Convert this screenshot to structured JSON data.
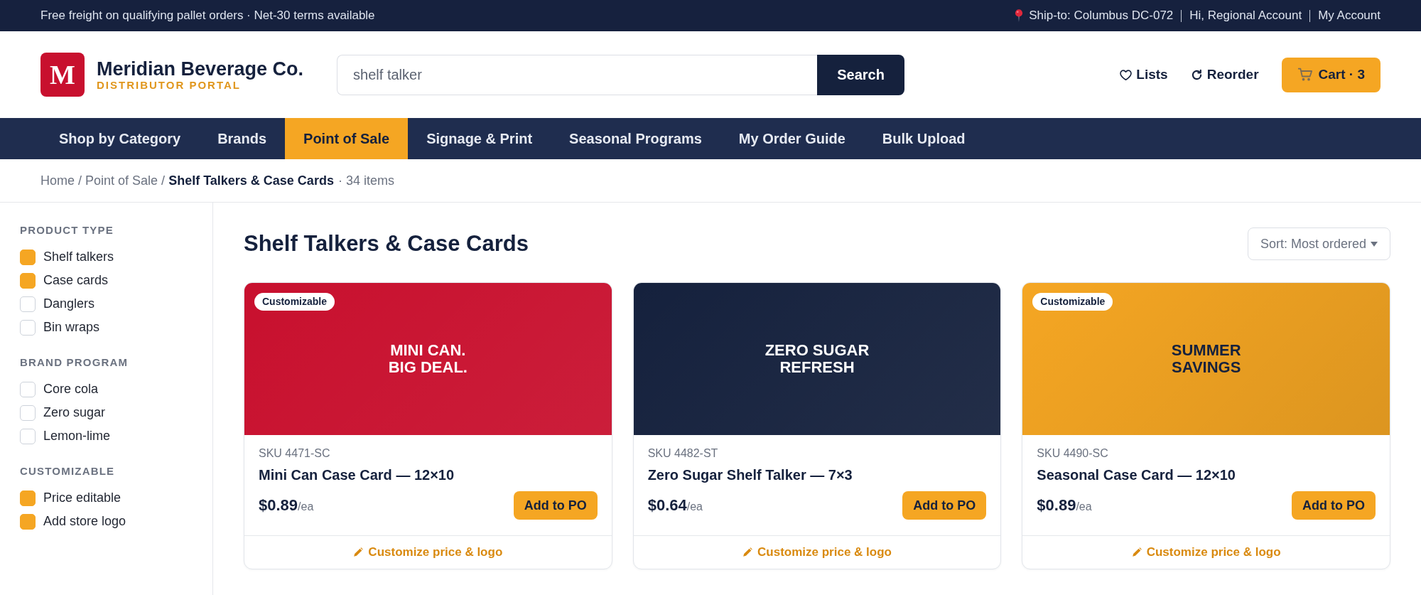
{
  "top_bar": {
    "promo": "Free freight on qualifying pallet orders · Net-30 terms available",
    "ship_to": "Ship-to: Columbus DC-072",
    "greeting": "Hi, Regional Account",
    "account_link": "My Account"
  },
  "header": {
    "logo": {
      "letter": "M",
      "name": "Meridian Beverage Co.",
      "tagline": "DISTRIBUTOR PORTAL"
    },
    "search": {
      "value": "shelf talker",
      "button": "Search"
    },
    "actions": [
      {
        "kind": "lists",
        "label": "Lists"
      },
      {
        "kind": "reorder",
        "label": "Reorder"
      },
      {
        "kind": "cart",
        "label": "Cart · 3"
      }
    ]
  },
  "nav": {
    "items": [
      {
        "label": "Shop by Category",
        "selected": false
      },
      {
        "label": "Brands",
        "selected": false
      },
      {
        "label": "Point of Sale",
        "selected": true
      },
      {
        "label": "Signage & Print",
        "selected": false
      },
      {
        "label": "Seasonal Programs",
        "selected": false
      },
      {
        "label": "My Order Guide",
        "selected": false
      },
      {
        "label": "Bulk Upload",
        "selected": false
      }
    ]
  },
  "breadcrumb": {
    "crumbs": [
      {
        "label": "Home",
        "current": false
      },
      {
        "separator": "/",
        "label": "Point of Sale",
        "current": false
      },
      {
        "separator": "/",
        "label": "Shelf Talkers & Case Cards",
        "current": true
      }
    ],
    "count": "· 34 items"
  },
  "filters": [
    {
      "title": "PRODUCT TYPE",
      "options": [
        {
          "label": "Shelf talkers",
          "checked": true
        },
        {
          "label": "Case cards",
          "checked": true
        },
        {
          "label": "Danglers",
          "checked": false
        },
        {
          "label": "Bin wraps",
          "checked": false
        }
      ]
    },
    {
      "title": "BRAND PROGRAM",
      "options": [
        {
          "label": "Core cola",
          "checked": false
        },
        {
          "label": "Zero sugar",
          "checked": false
        },
        {
          "label": "Lemon-lime",
          "checked": false
        }
      ]
    },
    {
      "title": "CUSTOMIZABLE",
      "options": [
        {
          "label": "Price editable",
          "checked": true
        },
        {
          "label": "Add store logo",
          "checked": true
        }
      ]
    }
  ],
  "listing": {
    "title": "Shelf Talkers & Case Cards",
    "sort": "Sort: Most ordered"
  },
  "products": [
    {
      "image": {
        "color": "#c8102e",
        "headline": "MINI CAN.\nBIG DEAL."
      },
      "badge": "Customizable",
      "sku": "SKU 4471-SC",
      "name": "Mini Can Case Card — 12×10",
      "price": "$0.89",
      "unit": "/ea",
      "button": "Add to PO",
      "customize_link": "Customize price & logo"
    },
    {
      "image": {
        "color": "#15213d",
        "headline": "ZERO SUGAR\nREFRESH"
      },
      "sku": "SKU 4482-ST",
      "name": "Zero Sugar Shelf Talker — 7×3",
      "price": "$0.64",
      "unit": "/ea",
      "button": "Add to PO",
      "customize_link": "Customize price & logo"
    },
    {
      "image": {
        "color": "#f5a623",
        "headline": "SUMMER\nSAVINGS"
      },
      "badge": "Customizable",
      "sku": "SKU 4490-SC",
      "name": "Seasonal Case Card — 12×10",
      "price": "$0.89",
      "unit": "/ea",
      "button": "Add to PO",
      "customize_link": "Customize price & logo"
    }
  ]
}
